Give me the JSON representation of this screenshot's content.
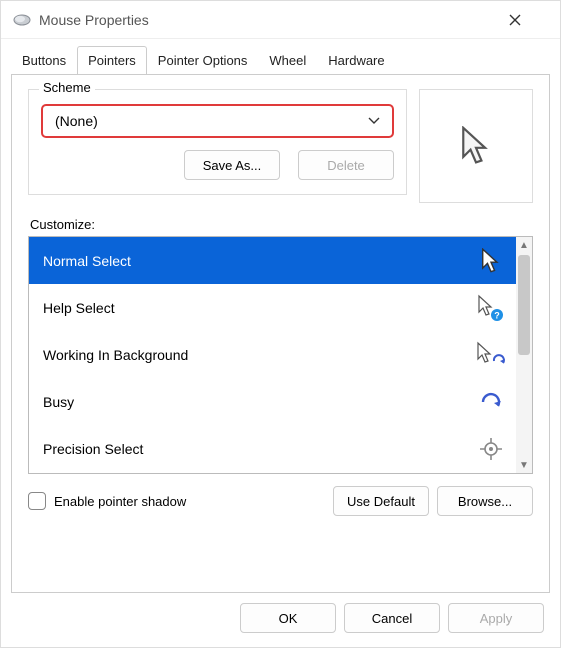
{
  "window": {
    "title": "Mouse Properties"
  },
  "tabs": [
    {
      "label": "Buttons",
      "active": false
    },
    {
      "label": "Pointers",
      "active": true
    },
    {
      "label": "Pointer Options",
      "active": false
    },
    {
      "label": "Wheel",
      "active": false
    },
    {
      "label": "Hardware",
      "active": false
    }
  ],
  "scheme": {
    "legend": "Scheme",
    "selected": "(None)",
    "save_as_label": "Save As...",
    "delete_label": "Delete"
  },
  "customize": {
    "label": "Customize:",
    "items": [
      {
        "label": "Normal Select",
        "icon": "cursor-arrow",
        "selected": true
      },
      {
        "label": "Help Select",
        "icon": "cursor-arrow-help",
        "selected": false
      },
      {
        "label": "Working In Background",
        "icon": "cursor-arrow-spinner",
        "selected": false
      },
      {
        "label": "Busy",
        "icon": "cursor-spinner",
        "selected": false
      },
      {
        "label": "Precision Select",
        "icon": "cursor-crosshair",
        "selected": false
      }
    ]
  },
  "enable_shadow": {
    "label": "Enable pointer shadow",
    "checked": false
  },
  "buttons": {
    "use_default": "Use Default",
    "browse": "Browse...",
    "ok": "OK",
    "cancel": "Cancel",
    "apply": "Apply"
  }
}
